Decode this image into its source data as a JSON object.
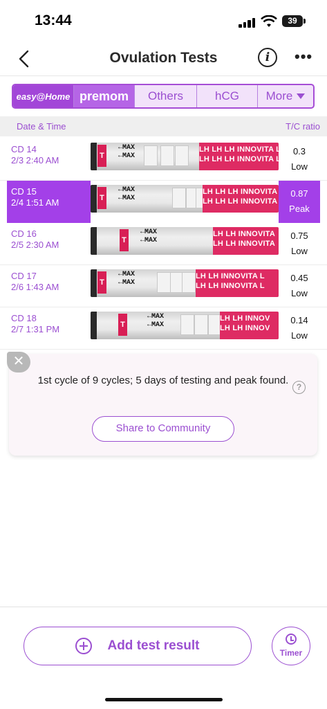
{
  "status_bar": {
    "time": "13:44",
    "battery": "39"
  },
  "header": {
    "title": "Ovulation Tests"
  },
  "tabs": [
    {
      "label": "easy@Home",
      "active": true
    },
    {
      "label": "premom",
      "active": false
    },
    {
      "label": "Others",
      "active": false
    },
    {
      "label": "hCG",
      "active": false
    },
    {
      "label": "More",
      "active": false
    }
  ],
  "list": {
    "col_date": "Date & Time",
    "col_ratio": "T/C ratio",
    "rows": [
      {
        "cd": "CD 14",
        "datetime": "2/3 2:40 AM",
        "ratio": "0.3",
        "level": "Low",
        "selected": false,
        "strip_text": "LH LH LH INNOVITA L",
        "strip_max": "MAX"
      },
      {
        "cd": "CD 15",
        "datetime": "2/4 1:51 AM",
        "ratio": "0.87",
        "level": "Peak",
        "selected": true,
        "strip_text": "LH LH LH INNOVITA L",
        "strip_max": "MAX"
      },
      {
        "cd": "CD 16",
        "datetime": "2/5 2:30 AM",
        "ratio": "0.75",
        "level": "Low",
        "selected": false,
        "strip_text": "LH LH INNOVITA",
        "strip_max": "MAX"
      },
      {
        "cd": "CD 17",
        "datetime": "2/6 1:43 AM",
        "ratio": "0.45",
        "level": "Low",
        "selected": false,
        "strip_text": "LH LH INNOVITA L",
        "strip_max": "MAX"
      },
      {
        "cd": "CD 18",
        "datetime": "2/7 1:31 PM",
        "ratio": "0.14",
        "level": "Low",
        "selected": false,
        "strip_text": "LH LH INNOV",
        "strip_max": "MAX"
      }
    ]
  },
  "summary": {
    "text": "1st cycle of 9 cycles; 5 days of testing and peak found.",
    "share_label": "Share to Community"
  },
  "bottom": {
    "add_label": "Add test result",
    "timer_label": "Timer"
  },
  "colors": {
    "accent": "#9b4fd1",
    "selected": "#a340e8",
    "strip_pink": "#de2b63"
  }
}
